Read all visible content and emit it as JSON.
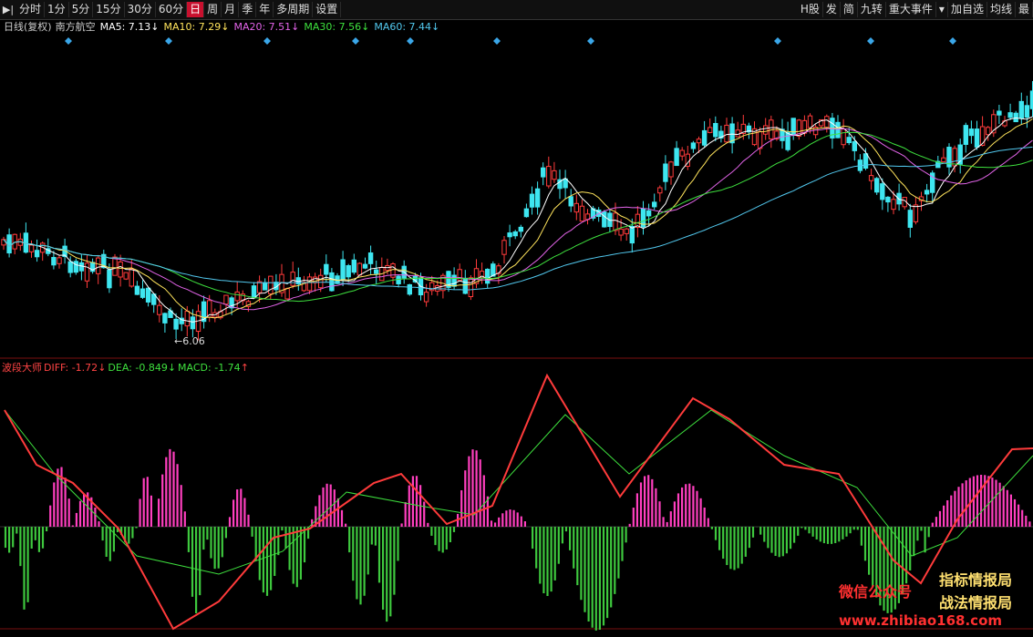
{
  "toolbar": {
    "periods": [
      "分时",
      "1分",
      "5分",
      "15分",
      "30分",
      "60分",
      "日",
      "周",
      "月",
      "季",
      "年",
      "多周期",
      "设置"
    ],
    "active_period": "日",
    "right_items": [
      "H股",
      "发",
      "简",
      "九转",
      "重大事件",
      "加自选",
      "均线",
      "最"
    ]
  },
  "main_chart": {
    "title": "日线(复权)",
    "stock_name": "南方航空",
    "ma": [
      {
        "label": "MA5: 7.13",
        "arrow": "↓",
        "color": "#ffffff"
      },
      {
        "label": "MA10: 7.29",
        "arrow": "↓",
        "color": "#ffe45c"
      },
      {
        "label": "MA20: 7.51",
        "arrow": "↓",
        "color": "#e264e8"
      },
      {
        "label": "MA30: 7.56",
        "arrow": "↓",
        "color": "#3ee03e"
      },
      {
        "label": "MA60: 7.44",
        "arrow": "↓",
        "color": "#52c8ee"
      }
    ],
    "low_label": "6.06"
  },
  "macd": {
    "name": "波段大师",
    "diff": "DIFF: -1.72",
    "diff_arrow": "↓",
    "dea": "DEA: -0.849",
    "dea_arrow": "↓",
    "macd": "MACD: -1.74",
    "macd_arrow": "↑",
    "colors": {
      "diff": "#ff3b3b",
      "dea": "#3ee03e",
      "pos": "#ff3fbf",
      "neg": "#3ec83e",
      "name": "#ff4444"
    }
  },
  "watermark": {
    "wechat": "微信公众号",
    "line1": "指标情报局",
    "line2": "战法情报局",
    "url": "www.zhibiao168.com"
  }
}
